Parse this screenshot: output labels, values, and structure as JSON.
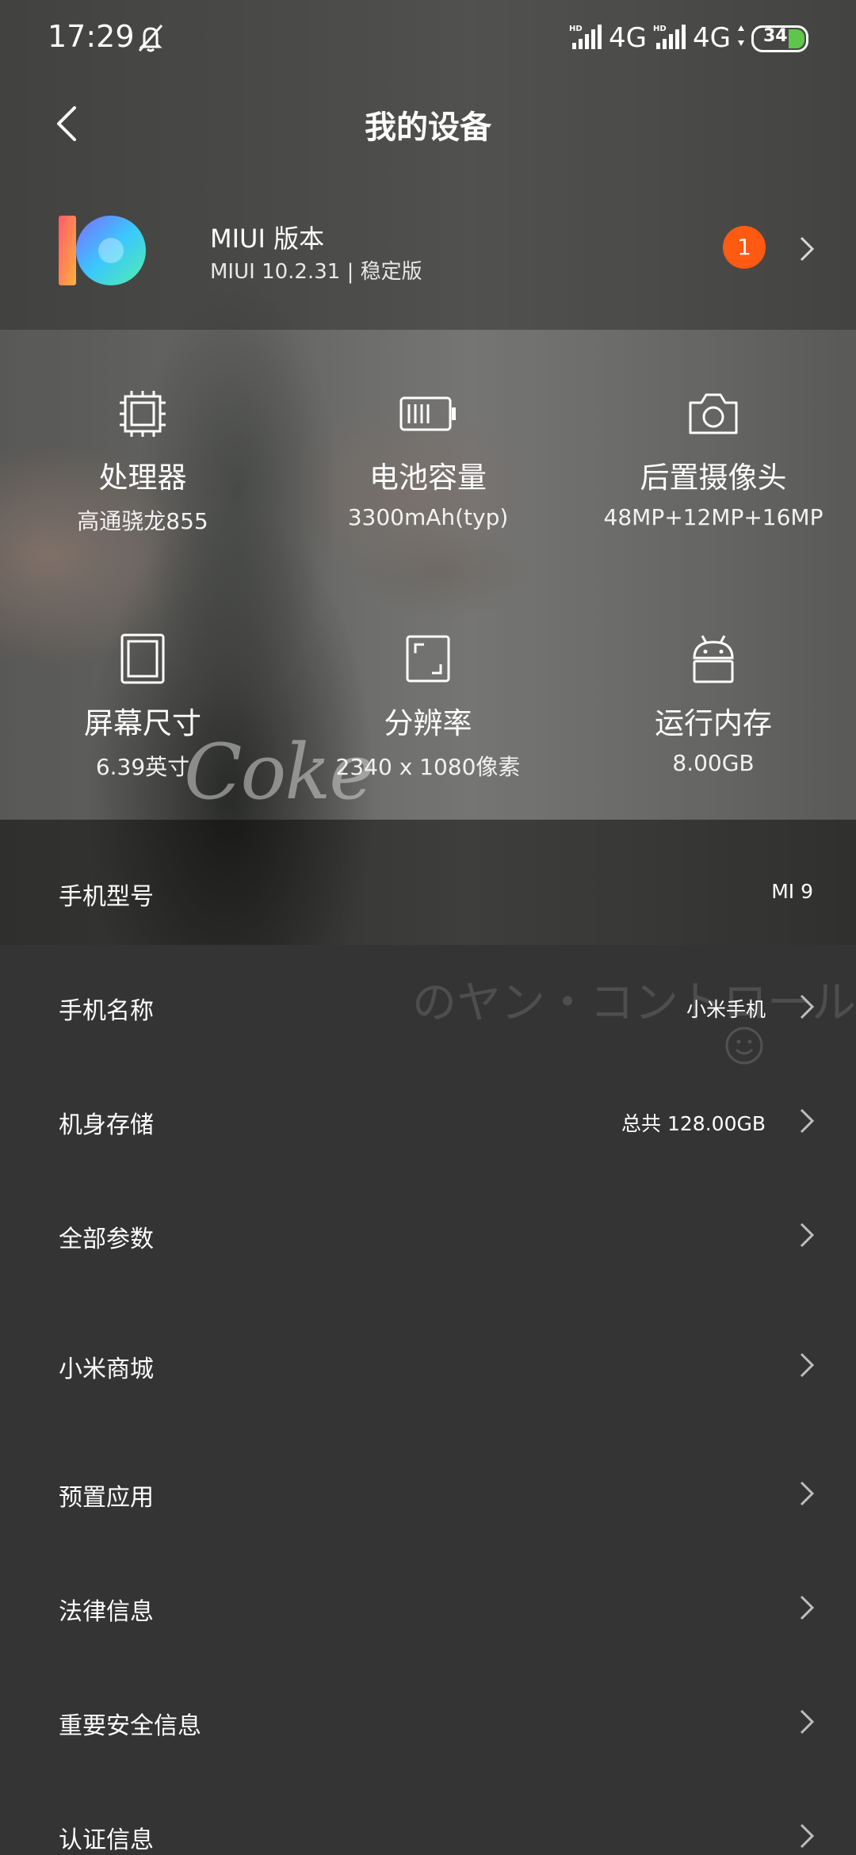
{
  "status": {
    "time": "17:29",
    "net1": "4G",
    "net2": "4G",
    "battery": "34",
    "hd": "HD"
  },
  "header": {
    "title": "我的设备"
  },
  "miui": {
    "name": "MIUI 版本",
    "version": "MIUI 10.2.31 | 稳定版",
    "badge": "1"
  },
  "specs": [
    {
      "label": "处理器",
      "value": "高通骁龙855",
      "icon": "cpu-icon"
    },
    {
      "label": "电池容量",
      "value": "3300mAh(typ)",
      "icon": "battery-icon"
    },
    {
      "label": "后置摄像头",
      "value": "48MP+12MP+16MP",
      "icon": "camera-icon"
    },
    {
      "label": "屏幕尺寸",
      "value": "6.39英寸",
      "icon": "screen-icon"
    },
    {
      "label": "分辨率",
      "value": "2340 x 1080像素",
      "icon": "resolution-icon"
    },
    {
      "label": "运行内存",
      "value": "8.00GB",
      "icon": "android-icon"
    }
  ],
  "watermark": "Coke",
  "rows": [
    {
      "label": "手机型号",
      "value": "MI 9"
    },
    {
      "label": "手机名称",
      "value": "小米手机"
    },
    {
      "label": "机身存储",
      "value": "总共 128.00GB"
    },
    {
      "label": "全部参数",
      "value": ""
    },
    {
      "label": "小米商城",
      "value": ""
    },
    {
      "label": "预置应用",
      "value": ""
    },
    {
      "label": "法律信息",
      "value": ""
    },
    {
      "label": "重要安全信息",
      "value": ""
    },
    {
      "label": "认证信息",
      "value": ""
    }
  ],
  "background_text": "のヤン・コントロール"
}
